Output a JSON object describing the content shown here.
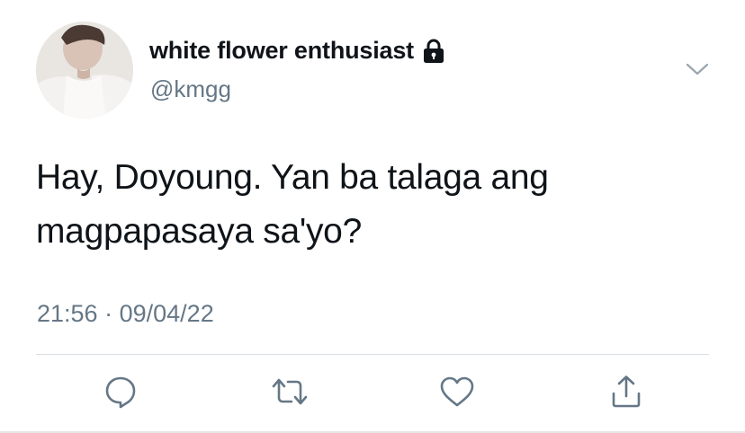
{
  "author": {
    "display_name": "white flower enthusiast",
    "handle": "@kmgg",
    "avatar_icon": "profile-photo",
    "protected_icon": "lock-icon"
  },
  "tweet": {
    "text_lines": [
      "Hay, Doyoung. Yan ba talaga ang",
      "magpapasaya sa'yo?"
    ],
    "time": "21:56",
    "separator": "·",
    "date": "09/04/22"
  },
  "actions": [
    {
      "icon": "reply-icon"
    },
    {
      "icon": "retweet-icon"
    },
    {
      "icon": "like-icon"
    },
    {
      "icon": "share-icon"
    }
  ],
  "colors": {
    "text": "#0f1419",
    "secondary": "#657786",
    "icon": "#657786",
    "divider": "#d9dee2"
  }
}
